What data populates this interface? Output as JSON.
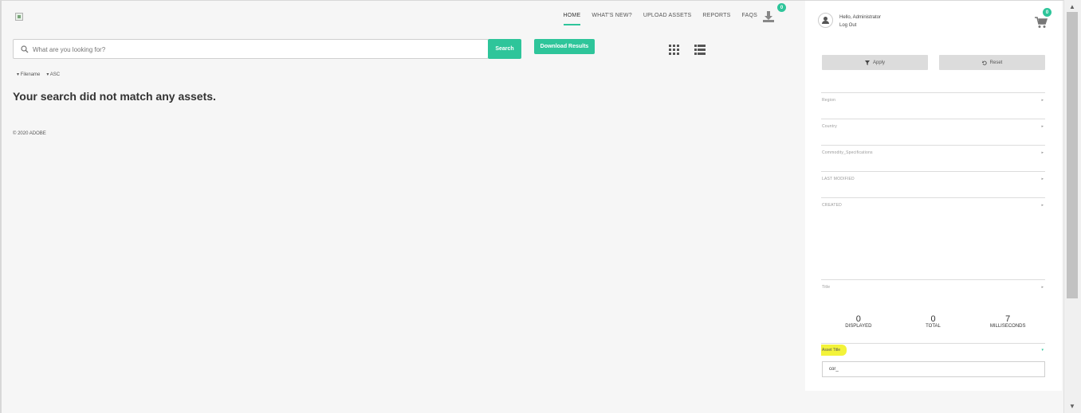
{
  "nav": {
    "items": [
      {
        "label": "HOME",
        "active": true
      },
      {
        "label": "WHAT'S NEW?",
        "active": false
      },
      {
        "label": "UPLOAD ASSETS",
        "active": false
      },
      {
        "label": "REPORTS",
        "active": false
      },
      {
        "label": "FAQS",
        "active": false
      }
    ],
    "download_badge": "0",
    "download_icon": "download-icon"
  },
  "search": {
    "placeholder": "What are you looking for?",
    "button_label": "Search",
    "download_results_label": "Download Results"
  },
  "view_toggles": [
    "grid-view-icon",
    "list-view-icon"
  ],
  "sort": {
    "field": "Filename",
    "order": "ASC"
  },
  "message": "Your search did not match any assets.",
  "footer": {
    "copyright": "© 2020 ADOBE"
  },
  "user": {
    "greeting": "Hello, Administrator",
    "logout_label": "Log Out"
  },
  "cart": {
    "badge": "0",
    "icon": "cart-icon"
  },
  "filters": {
    "apply_label": "Apply",
    "reset_label": "Reset",
    "facets": [
      "Region",
      "Country",
      "Commodity_Specifications",
      "LAST MODIFIED",
      "CREATED",
      "Title"
    ],
    "asset_title_label": "Asset Title",
    "asset_title_value": "cor_"
  },
  "stats": [
    {
      "value": "0",
      "label": "DISPLAYED"
    },
    {
      "value": "0",
      "label": "TOTAL"
    },
    {
      "value": "7",
      "label": "MILLISECONDS"
    }
  ],
  "colors": {
    "accent": "#2ec59a",
    "highlight": "#f3f33a"
  }
}
